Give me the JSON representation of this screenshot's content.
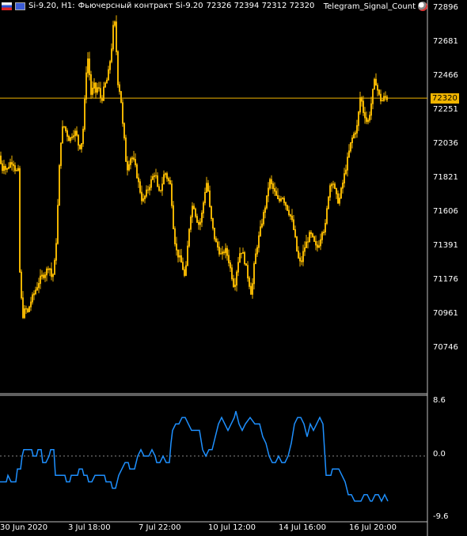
{
  "header": {
    "symbol": "Si-9.20, H1:",
    "description": "Фьючерсный контракт Si-9.20",
    "ohlc": "72326 72394 72312 72320",
    "indicator_name": "Telegram_Signal_Count"
  },
  "colors": {
    "background": "#000000",
    "candle": "#f0b400",
    "indicator": "#1e90ff",
    "price_line": "#f0b400",
    "axis": "#ffffff"
  },
  "price_axis": [
    "72896",
    "72681",
    "72466",
    "72251",
    "72036",
    "71821",
    "71606",
    "71391",
    "71176",
    "70961",
    "70746"
  ],
  "current_price": "72320",
  "indicator_axis": [
    "8.6",
    "0.0",
    "-9.6"
  ],
  "time_axis": [
    "30 Jun 2020",
    "3 Jul 18:00",
    "7 Jul 22:00",
    "10 Jul 12:00",
    "14 Jul 16:00",
    "16 Jul 20:00"
  ],
  "chart_data": {
    "type": "line",
    "price_range": [
      70640,
      72896
    ],
    "current_price": 72320,
    "price_path": [
      [
        0,
        71950
      ],
      [
        2,
        71850
      ],
      [
        5,
        71900
      ],
      [
        8,
        71850
      ],
      [
        12,
        71900
      ],
      [
        16,
        71920
      ],
      [
        20,
        71850
      ],
      [
        23,
        71850
      ],
      [
        24,
        71300
      ],
      [
        26,
        71100
      ],
      [
        28,
        70950
      ],
      [
        30,
        70900
      ],
      [
        32,
        71000
      ],
      [
        34,
        70920
      ],
      [
        38,
        71000
      ],
      [
        42,
        71050
      ],
      [
        46,
        71100
      ],
      [
        50,
        71150
      ],
      [
        54,
        71180
      ],
      [
        58,
        71200
      ],
      [
        62,
        71250
      ],
      [
        66,
        71150
      ],
      [
        70,
        71300
      ],
      [
        72,
        71500
      ],
      [
        74,
        71750
      ],
      [
        76,
        72000
      ],
      [
        78,
        72100
      ],
      [
        80,
        72150
      ],
      [
        84,
        72100
      ],
      [
        88,
        72050
      ],
      [
        92,
        72100
      ],
      [
        96,
        72100
      ],
      [
        100,
        72000
      ],
      [
        104,
        72050
      ],
      [
        106,
        72200
      ],
      [
        108,
        72400
      ],
      [
        110,
        72600
      ],
      [
        112,
        72550
      ],
      [
        114,
        72400
      ],
      [
        116,
        72300
      ],
      [
        118,
        72450
      ],
      [
        120,
        72350
      ],
      [
        124,
        72400
      ],
      [
        128,
        72300
      ],
      [
        132,
        72400
      ],
      [
        136,
        72450
      ],
      [
        140,
        72600
      ],
      [
        142,
        72700
      ],
      [
        144,
        72850
      ],
      [
        146,
        72750
      ],
      [
        148,
        72500
      ],
      [
        150,
        72350
      ],
      [
        152,
        72400
      ],
      [
        154,
        72200
      ],
      [
        156,
        72100
      ],
      [
        158,
        72000
      ],
      [
        160,
        71850
      ],
      [
        162,
        71900
      ],
      [
        166,
        71950
      ],
      [
        170,
        71900
      ],
      [
        174,
        71800
      ],
      [
        178,
        71700
      ],
      [
        180,
        71650
      ],
      [
        184,
        71700
      ],
      [
        188,
        71750
      ],
      [
        192,
        71800
      ],
      [
        196,
        71850
      ],
      [
        200,
        71700
      ],
      [
        204,
        71750
      ],
      [
        208,
        71850
      ],
      [
        212,
        71800
      ],
      [
        216,
        71750
      ],
      [
        218,
        71550
      ],
      [
        220,
        71450
      ],
      [
        222,
        71350
      ],
      [
        226,
        71300
      ],
      [
        230,
        71250
      ],
      [
        234,
        71150
      ],
      [
        236,
        71300
      ],
      [
        240,
        71550
      ],
      [
        244,
        71650
      ],
      [
        248,
        71550
      ],
      [
        252,
        71500
      ],
      [
        256,
        71600
      ],
      [
        258,
        71700
      ],
      [
        262,
        71800
      ],
      [
        264,
        71650
      ],
      [
        268,
        71500
      ],
      [
        272,
        71400
      ],
      [
        276,
        71350
      ],
      [
        280,
        71300
      ],
      [
        284,
        71350
      ],
      [
        288,
        71300
      ],
      [
        292,
        71200
      ],
      [
        296,
        71100
      ],
      [
        300,
        71250
      ],
      [
        304,
        71350
      ],
      [
        308,
        71300
      ],
      [
        312,
        71200
      ],
      [
        316,
        71100
      ],
      [
        318,
        71050
      ],
      [
        320,
        71200
      ],
      [
        324,
        71350
      ],
      [
        328,
        71450
      ],
      [
        332,
        71550
      ],
      [
        336,
        71650
      ],
      [
        338,
        71700
      ],
      [
        340,
        71800
      ],
      [
        344,
        71750
      ],
      [
        348,
        71700
      ],
      [
        352,
        71650
      ],
      [
        356,
        71700
      ],
      [
        360,
        71650
      ],
      [
        364,
        71600
      ],
      [
        368,
        71550
      ],
      [
        372,
        71450
      ],
      [
        376,
        71300
      ],
      [
        380,
        71250
      ],
      [
        384,
        71350
      ],
      [
        388,
        71400
      ],
      [
        392,
        71450
      ],
      [
        396,
        71400
      ],
      [
        400,
        71350
      ],
      [
        404,
        71400
      ],
      [
        408,
        71500
      ],
      [
        410,
        71450
      ],
      [
        414,
        71650
      ],
      [
        416,
        71750
      ],
      [
        420,
        71800
      ],
      [
        424,
        71700
      ],
      [
        428,
        71650
      ],
      [
        432,
        71750
      ],
      [
        436,
        71850
      ],
      [
        440,
        71950
      ],
      [
        444,
        72050
      ],
      [
        448,
        72100
      ],
      [
        452,
        72150
      ],
      [
        454,
        72300
      ],
      [
        456,
        72350
      ],
      [
        458,
        72250
      ],
      [
        462,
        72200
      ],
      [
        464,
        72150
      ],
      [
        468,
        72250
      ],
      [
        472,
        72400
      ],
      [
        474,
        72450
      ],
      [
        478,
        72350
      ],
      [
        482,
        72300
      ],
      [
        486,
        72330
      ],
      [
        490,
        72320
      ]
    ],
    "indicator_path": [
      [
        0,
        -4
      ],
      [
        8,
        -4
      ],
      [
        10,
        -3
      ],
      [
        14,
        -4
      ],
      [
        20,
        -4
      ],
      [
        22,
        -2
      ],
      [
        26,
        -2
      ],
      [
        28,
        0
      ],
      [
        30,
        1
      ],
      [
        40,
        1
      ],
      [
        42,
        0
      ],
      [
        46,
        0
      ],
      [
        48,
        1
      ],
      [
        52,
        1
      ],
      [
        54,
        -1
      ],
      [
        58,
        -1
      ],
      [
        62,
        0
      ],
      [
        64,
        1
      ],
      [
        68,
        1
      ],
      [
        70,
        -3
      ],
      [
        78,
        -3
      ],
      [
        82,
        -3
      ],
      [
        84,
        -4
      ],
      [
        88,
        -4
      ],
      [
        90,
        -3
      ],
      [
        94,
        -3
      ],
      [
        98,
        -3
      ],
      [
        100,
        -2
      ],
      [
        104,
        -2
      ],
      [
        106,
        -3
      ],
      [
        110,
        -3
      ],
      [
        112,
        -4
      ],
      [
        116,
        -4
      ],
      [
        120,
        -3
      ],
      [
        126,
        -3
      ],
      [
        132,
        -3
      ],
      [
        134,
        -4
      ],
      [
        140,
        -4
      ],
      [
        142,
        -5
      ],
      [
        146,
        -5
      ],
      [
        150,
        -3
      ],
      [
        154,
        -2
      ],
      [
        158,
        -1
      ],
      [
        162,
        -1
      ],
      [
        164,
        -2
      ],
      [
        170,
        -2
      ],
      [
        174,
        0
      ],
      [
        178,
        1
      ],
      [
        182,
        0
      ],
      [
        188,
        0
      ],
      [
        192,
        1
      ],
      [
        196,
        0
      ],
      [
        198,
        -1
      ],
      [
        202,
        -1
      ],
      [
        206,
        0
      ],
      [
        210,
        -1
      ],
      [
        214,
        -1
      ],
      [
        216,
        2
      ],
      [
        218,
        4
      ],
      [
        222,
        5
      ],
      [
        226,
        5
      ],
      [
        230,
        6
      ],
      [
        234,
        6
      ],
      [
        238,
        5
      ],
      [
        242,
        4
      ],
      [
        248,
        4
      ],
      [
        252,
        4
      ],
      [
        256,
        1
      ],
      [
        260,
        0
      ],
      [
        264,
        1
      ],
      [
        268,
        1
      ],
      [
        272,
        3
      ],
      [
        276,
        5
      ],
      [
        280,
        6
      ],
      [
        284,
        5
      ],
      [
        288,
        4
      ],
      [
        292,
        5
      ],
      [
        296,
        6
      ],
      [
        298,
        7
      ],
      [
        302,
        5
      ],
      [
        306,
        4
      ],
      [
        310,
        5
      ],
      [
        316,
        6
      ],
      [
        322,
        5
      ],
      [
        328,
        5
      ],
      [
        332,
        3
      ],
      [
        336,
        2
      ],
      [
        340,
        0
      ],
      [
        344,
        -1
      ],
      [
        348,
        -1
      ],
      [
        352,
        0
      ],
      [
        356,
        -1
      ],
      [
        360,
        -1
      ],
      [
        364,
        0
      ],
      [
        368,
        2
      ],
      [
        372,
        5
      ],
      [
        376,
        6
      ],
      [
        380,
        6
      ],
      [
        384,
        5
      ],
      [
        388,
        3
      ],
      [
        392,
        5
      ],
      [
        396,
        4
      ],
      [
        400,
        5
      ],
      [
        404,
        6
      ],
      [
        408,
        5
      ],
      [
        412,
        -3
      ],
      [
        418,
        -3
      ],
      [
        420,
        -2
      ],
      [
        424,
        -2
      ],
      [
        428,
        -2
      ],
      [
        432,
        -3
      ],
      [
        436,
        -4
      ],
      [
        440,
        -6
      ],
      [
        444,
        -6
      ],
      [
        448,
        -7
      ],
      [
        452,
        -7
      ],
      [
        456,
        -7
      ],
      [
        460,
        -6
      ],
      [
        464,
        -6
      ],
      [
        468,
        -7
      ],
      [
        470,
        -7
      ],
      [
        474,
        -6
      ],
      [
        478,
        -6
      ],
      [
        482,
        -7
      ],
      [
        486,
        -6
      ],
      [
        490,
        -7
      ]
    ]
  }
}
